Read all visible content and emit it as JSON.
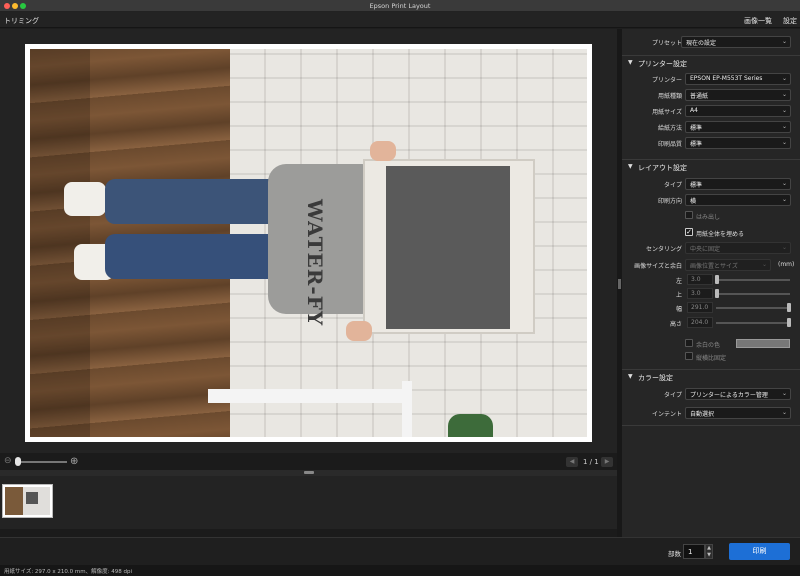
{
  "window": {
    "title": "Epson Print Layout"
  },
  "menubar": {
    "left": "トリミング",
    "image_list": "画像一覧",
    "settings": "設定"
  },
  "preview": {
    "page_indicator": "1 / 1",
    "sweater_text": "WATER-FY"
  },
  "panel": {
    "preset": {
      "label": "プリセット",
      "value": "現在の設定"
    },
    "printer_section": {
      "title": "プリンター設定",
      "printer": {
        "label": "プリンター",
        "value": "EPSON EP-M553T Series"
      },
      "paper_type": {
        "label": "用紙種類",
        "value": "普通紙"
      },
      "paper_size": {
        "label": "用紙サイズ",
        "value": "A4"
      },
      "feed": {
        "label": "給紙方法",
        "value": "標準"
      },
      "quality": {
        "label": "印刷品質",
        "value": "標準"
      }
    },
    "layout_section": {
      "title": "レイアウト設定",
      "type": {
        "label": "タイプ",
        "value": "標準"
      },
      "orientation": {
        "label": "印刷方向",
        "value": "横"
      },
      "borderless_label": "はみ出し",
      "fill_label": "用紙全体を埋める",
      "centering": {
        "label": "センタリング",
        "value": "中央に固定"
      },
      "image_size": {
        "label": "画像サイズと余白",
        "value": "画像位置とサイズ",
        "unit": "(mm)"
      },
      "left": {
        "label": "左",
        "value": "3.0"
      },
      "top": {
        "label": "上",
        "value": "3.0"
      },
      "width": {
        "label": "幅",
        "value": "291.0"
      },
      "height": {
        "label": "高さ",
        "value": "204.0"
      },
      "margin_color_label": "余白の色",
      "aspect_label": "縦横比固定"
    },
    "color_section": {
      "title": "カラー設定",
      "type": {
        "label": "タイプ",
        "value": "プリンターによるカラー管理"
      },
      "intent": {
        "label": "インテント",
        "value": "自動選択"
      }
    }
  },
  "footer": {
    "copies_label": "部数",
    "copies_value": "1",
    "print_label": "印刷"
  },
  "status": {
    "text": "用紙サイズ: 297.0 x 210.0 mm、解像度: 498 dpi"
  },
  "glyphs": {
    "checkmark": "✓",
    "arrow": "⌄",
    "triangle": "▼",
    "zoom_out": "⊖",
    "zoom_in": "⊕",
    "prev": "◀",
    "next": "▶",
    "up": "▲",
    "down": "▼"
  }
}
